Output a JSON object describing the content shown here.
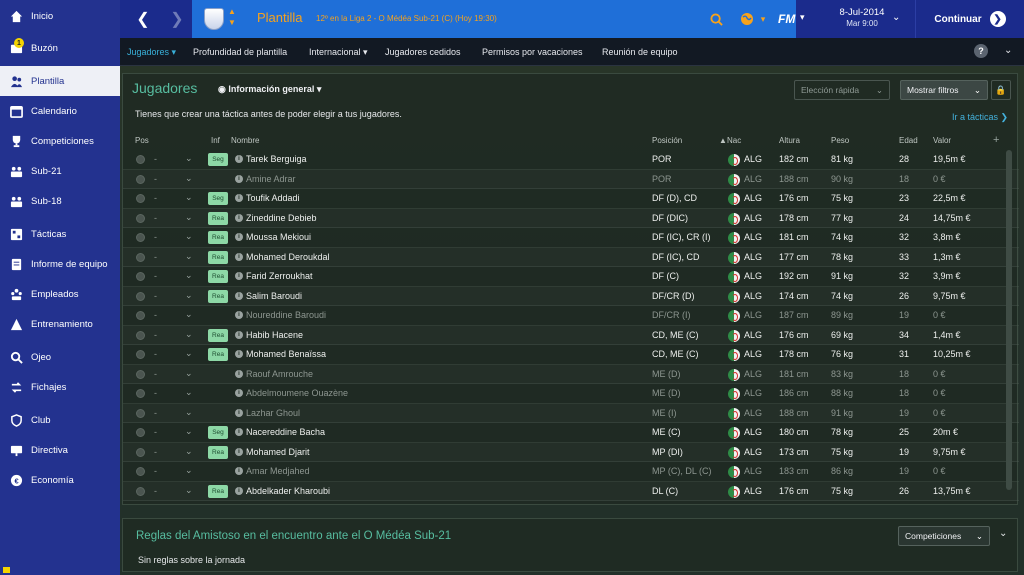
{
  "sidebar": {
    "items": [
      {
        "label": "Inicio",
        "icon": "home-icon"
      },
      {
        "label": "Buzón",
        "icon": "inbox-icon",
        "badge": "1"
      },
      {
        "label": "Plantilla",
        "icon": "squad-icon",
        "active": true
      },
      {
        "label": "Calendario",
        "icon": "calendar-icon"
      },
      {
        "label": "Competiciones",
        "icon": "trophy-icon"
      },
      {
        "label": "Sub-21",
        "icon": "team-icon"
      },
      {
        "label": "Sub-18",
        "icon": "team-icon"
      },
      {
        "label": "Tácticas",
        "icon": "tactics-icon"
      },
      {
        "label": "Informe de equipo",
        "icon": "report-icon"
      },
      {
        "label": "Empleados",
        "icon": "staff-icon"
      },
      {
        "label": "Entrenamiento",
        "icon": "training-icon"
      },
      {
        "label": "Ojeo",
        "icon": "search-icon"
      },
      {
        "label": "Fichajes",
        "icon": "transfers-icon"
      },
      {
        "label": "Club",
        "icon": "shield-icon"
      },
      {
        "label": "Directiva",
        "icon": "board-icon"
      },
      {
        "label": "Economía",
        "icon": "finance-icon"
      }
    ]
  },
  "header": {
    "title": "Plantilla",
    "subtitle": "12º en la Liga 2 - O Médéa Sub-21 (C) (Hoy 19:30)",
    "logo": "FM",
    "date": "8-Jul-2014",
    "day_time": "Mar 9:00",
    "continue_label": "Continuar",
    "accent_color": "#f7a21b"
  },
  "subnav": {
    "tabs": [
      {
        "label": "Jugadores",
        "active": true,
        "dropdown": true
      },
      {
        "label": "Profundidad de plantilla"
      },
      {
        "label": "Internacional",
        "dropdown": true
      },
      {
        "label": "Jugadores cedidos"
      },
      {
        "label": "Permisos por vacaciones"
      },
      {
        "label": "Reunión de equipo"
      }
    ],
    "help_label": "?"
  },
  "players_panel": {
    "title": "Jugadores",
    "view": "Información general",
    "quick_select": "Elección rápida",
    "filters": "Mostrar filtros",
    "message": "Tienes que crear una táctica antes de poder elegir a tus jugadores.",
    "tactics_link": "Ir a tácticas",
    "columns": {
      "pos": "Pos",
      "inf": "Inf",
      "name": "Nombre",
      "position": "Posición",
      "nat": "Nac",
      "height": "Altura",
      "weight": "Peso",
      "age": "Edad",
      "value": "Valor"
    }
  },
  "players": [
    {
      "pos": "-",
      "inf": "Seg",
      "name": "Tarek Berguiga",
      "position": "POR",
      "nat": "ALG",
      "height": "182 cm",
      "weight": "81 kg",
      "age": "28",
      "value": "19,5m €",
      "dim": false
    },
    {
      "pos": "-",
      "inf": "",
      "name": "Amine Adrar",
      "position": "POR",
      "nat": "ALG",
      "height": "188 cm",
      "weight": "90 kg",
      "age": "18",
      "value": "0 €",
      "dim": true
    },
    {
      "pos": "-",
      "inf": "Seg",
      "name": "Toufik Addadi",
      "position": "DF (D), CD",
      "nat": "ALG",
      "height": "176 cm",
      "weight": "75 kg",
      "age": "23",
      "value": "22,5m €",
      "dim": false
    },
    {
      "pos": "-",
      "inf": "Rea",
      "name": "Zineddine Debieb",
      "position": "DF (DIC)",
      "nat": "ALG",
      "height": "178 cm",
      "weight": "77 kg",
      "age": "24",
      "value": "14,75m €",
      "dim": false
    },
    {
      "pos": "-",
      "inf": "Rea",
      "name": "Moussa Mekioui",
      "position": "DF (IC), CR (I)",
      "nat": "ALG",
      "height": "181 cm",
      "weight": "74 kg",
      "age": "32",
      "value": "3,8m €",
      "dim": false
    },
    {
      "pos": "-",
      "inf": "Rea",
      "name": "Mohamed Deroukdal",
      "position": "DF (IC), CD",
      "nat": "ALG",
      "height": "177 cm",
      "weight": "78 kg",
      "age": "33",
      "value": "1,3m €",
      "dim": false
    },
    {
      "pos": "-",
      "inf": "Rea",
      "name": "Farid Zerroukhat",
      "position": "DF (C)",
      "nat": "ALG",
      "height": "192 cm",
      "weight": "91 kg",
      "age": "32",
      "value": "3,9m €",
      "dim": false
    },
    {
      "pos": "-",
      "inf": "Rea",
      "name": "Salim Baroudi",
      "position": "DF/CR (D)",
      "nat": "ALG",
      "height": "174 cm",
      "weight": "74 kg",
      "age": "26",
      "value": "9,75m €",
      "dim": false
    },
    {
      "pos": "-",
      "inf": "",
      "name": "Noureddine Baroudi",
      "position": "DF/CR (I)",
      "nat": "ALG",
      "height": "187 cm",
      "weight": "89 kg",
      "age": "19",
      "value": "0 €",
      "dim": true
    },
    {
      "pos": "-",
      "inf": "Rea",
      "name": "Habib Hacene",
      "position": "CD, ME (C)",
      "nat": "ALG",
      "height": "176 cm",
      "weight": "69 kg",
      "age": "34",
      "value": "1,4m €",
      "dim": false
    },
    {
      "pos": "-",
      "inf": "Rea",
      "name": "Mohamed Benaïssa",
      "position": "CD, ME (C)",
      "nat": "ALG",
      "height": "178 cm",
      "weight": "76 kg",
      "age": "31",
      "value": "10,25m €",
      "dim": false
    },
    {
      "pos": "-",
      "inf": "",
      "name": "Raouf Amrouche",
      "position": "ME (D)",
      "nat": "ALG",
      "height": "181 cm",
      "weight": "83 kg",
      "age": "18",
      "value": "0 €",
      "dim": true
    },
    {
      "pos": "-",
      "inf": "",
      "name": "Abdelmoumene Ouazène",
      "position": "ME (D)",
      "nat": "ALG",
      "height": "186 cm",
      "weight": "88 kg",
      "age": "18",
      "value": "0 €",
      "dim": true
    },
    {
      "pos": "-",
      "inf": "",
      "name": "Lazhar Ghoul",
      "position": "ME (I)",
      "nat": "ALG",
      "height": "188 cm",
      "weight": "91 kg",
      "age": "19",
      "value": "0 €",
      "dim": true
    },
    {
      "pos": "-",
      "inf": "Seg",
      "name": "Nacereddine Bacha",
      "position": "ME (C)",
      "nat": "ALG",
      "height": "180 cm",
      "weight": "78 kg",
      "age": "25",
      "value": "20m €",
      "dim": false
    },
    {
      "pos": "-",
      "inf": "Rea",
      "name": "Mohamed Djarit",
      "position": "MP (DI)",
      "nat": "ALG",
      "height": "173 cm",
      "weight": "75 kg",
      "age": "19",
      "value": "9,75m €",
      "dim": false
    },
    {
      "pos": "-",
      "inf": "",
      "name": "Amar Medjahed",
      "position": "MP (C), DL (C)",
      "nat": "ALG",
      "height": "183 cm",
      "weight": "86 kg",
      "age": "19",
      "value": "0 €",
      "dim": true
    },
    {
      "pos": "-",
      "inf": "Rea",
      "name": "Abdelkader Kharoubi",
      "position": "DL (C)",
      "nat": "ALG",
      "height": "176 cm",
      "weight": "75 kg",
      "age": "26",
      "value": "13,75m €",
      "dim": false
    }
  ],
  "rules_panel": {
    "title": "Reglas del Amistoso en el encuentro ante el O Médéa Sub-21",
    "text": "Sin reglas sobre la jornada",
    "competitions": "Competiciones"
  }
}
